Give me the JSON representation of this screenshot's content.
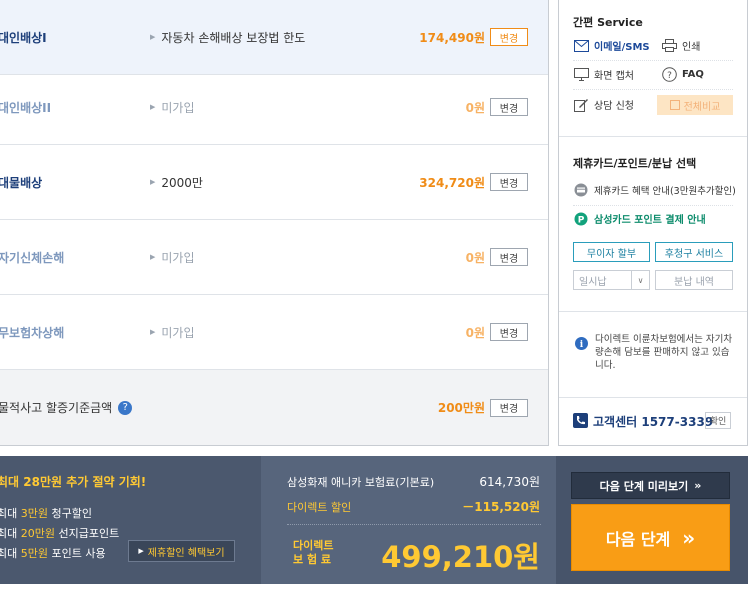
{
  "coverages": [
    {
      "name": "대인배상I",
      "detail": "자동차 손해배상 보장법 한도",
      "amount": "174,490원",
      "button": "변경",
      "active": true
    },
    {
      "name": "대인배상II",
      "detail": "미가입",
      "amount": "0원",
      "button": "변경",
      "active": false
    },
    {
      "name": "대물배상",
      "detail": "2000만",
      "amount": "324,720원",
      "button": "변경",
      "active": true
    },
    {
      "name": "자기신체손해",
      "detail": "미가입",
      "amount": "0원",
      "button": "변경",
      "active": false
    },
    {
      "name": "무보험차상해",
      "detail": "미가입",
      "amount": "0원",
      "button": "변경",
      "active": false
    },
    {
      "name": "물적사고 할증기준금액",
      "detail": "",
      "amount": "200만원",
      "button": "변경",
      "active": true
    }
  ],
  "side": {
    "service_title": "간편 Service",
    "email_sms": "이메일/SMS",
    "print": "인쇄",
    "capture": "화면 캡처",
    "faq": "FAQ",
    "consult": "상담 신청",
    "compare": "전체비교",
    "card_title": "제휴카드/포인트/분납 선택",
    "card_benefit": "제휴카드 혜택 안내(3만원추가할인)",
    "samsung_point": "삼성카드 포인트 결제 안내",
    "no_interest": "무이자 할부",
    "charge_service": "후청구 서비스",
    "lump_sum": "일시납",
    "installment_detail": "분납 내역",
    "notice": "다이렉트 이륜차보험에서는 자기차량손해 담보를 판매하지 않고 있습니다.",
    "call_center_label": "고객센터",
    "call_center_number": "1577-3339",
    "call_center_btn": "확인"
  },
  "promo": {
    "title": "최대 28만원 추가 절약 기회!",
    "line1_prefix": "최대 ",
    "line1_amount": "3만원",
    "line1_suffix": " 청구할인",
    "line2_prefix": "최대 ",
    "line2_amount": "20만원",
    "line2_suffix": " 선지급포인트",
    "line3_prefix": "최대 ",
    "line3_amount": "5만원",
    "line3_suffix": " 포인트 사용",
    "benefit_btn": "제휴할인 혜택보기"
  },
  "price": {
    "base_label": "삼성화재 애니카 보험료(기본료)",
    "base_value": "614,730원",
    "disc_label": "다이렉트 할인",
    "disc_value": "－115,520원",
    "final_label_1": "다이렉트",
    "final_label_2": "보 험 료",
    "final_value": "499,210원"
  },
  "actions": {
    "preview": "다음 단계 미리보기",
    "next": "다음 단계"
  },
  "colors": {
    "accent_orange": "#f99d15",
    "navy": "#1d3f7a",
    "bar_bg": "#47546a",
    "highlight_yellow": "#ffc933"
  }
}
